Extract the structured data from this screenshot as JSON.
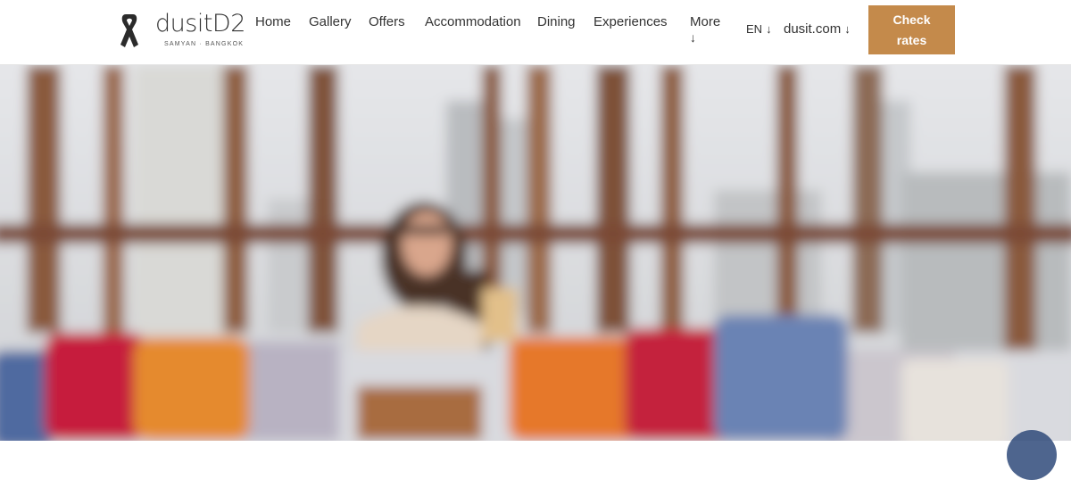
{
  "header": {
    "brand": "dusitD2",
    "tagline": "SAMYAN · BANGKOK",
    "nav": [
      "Home",
      "Gallery",
      "Offers",
      "Accommodation",
      "Dining",
      "Experiences"
    ],
    "more_label": "More",
    "more_arrow": "↓",
    "language": "EN",
    "language_arrow": "↓",
    "site_link": "dusit.com",
    "site_arrow": "↓",
    "cta_line1": "Check",
    "cta_line2": "rates"
  },
  "colors": {
    "accent": "#c48a4b",
    "text": "#333333",
    "header_bg": "#ffffff"
  },
  "hero": {
    "icon": "blurred-rooftop-photo"
  }
}
